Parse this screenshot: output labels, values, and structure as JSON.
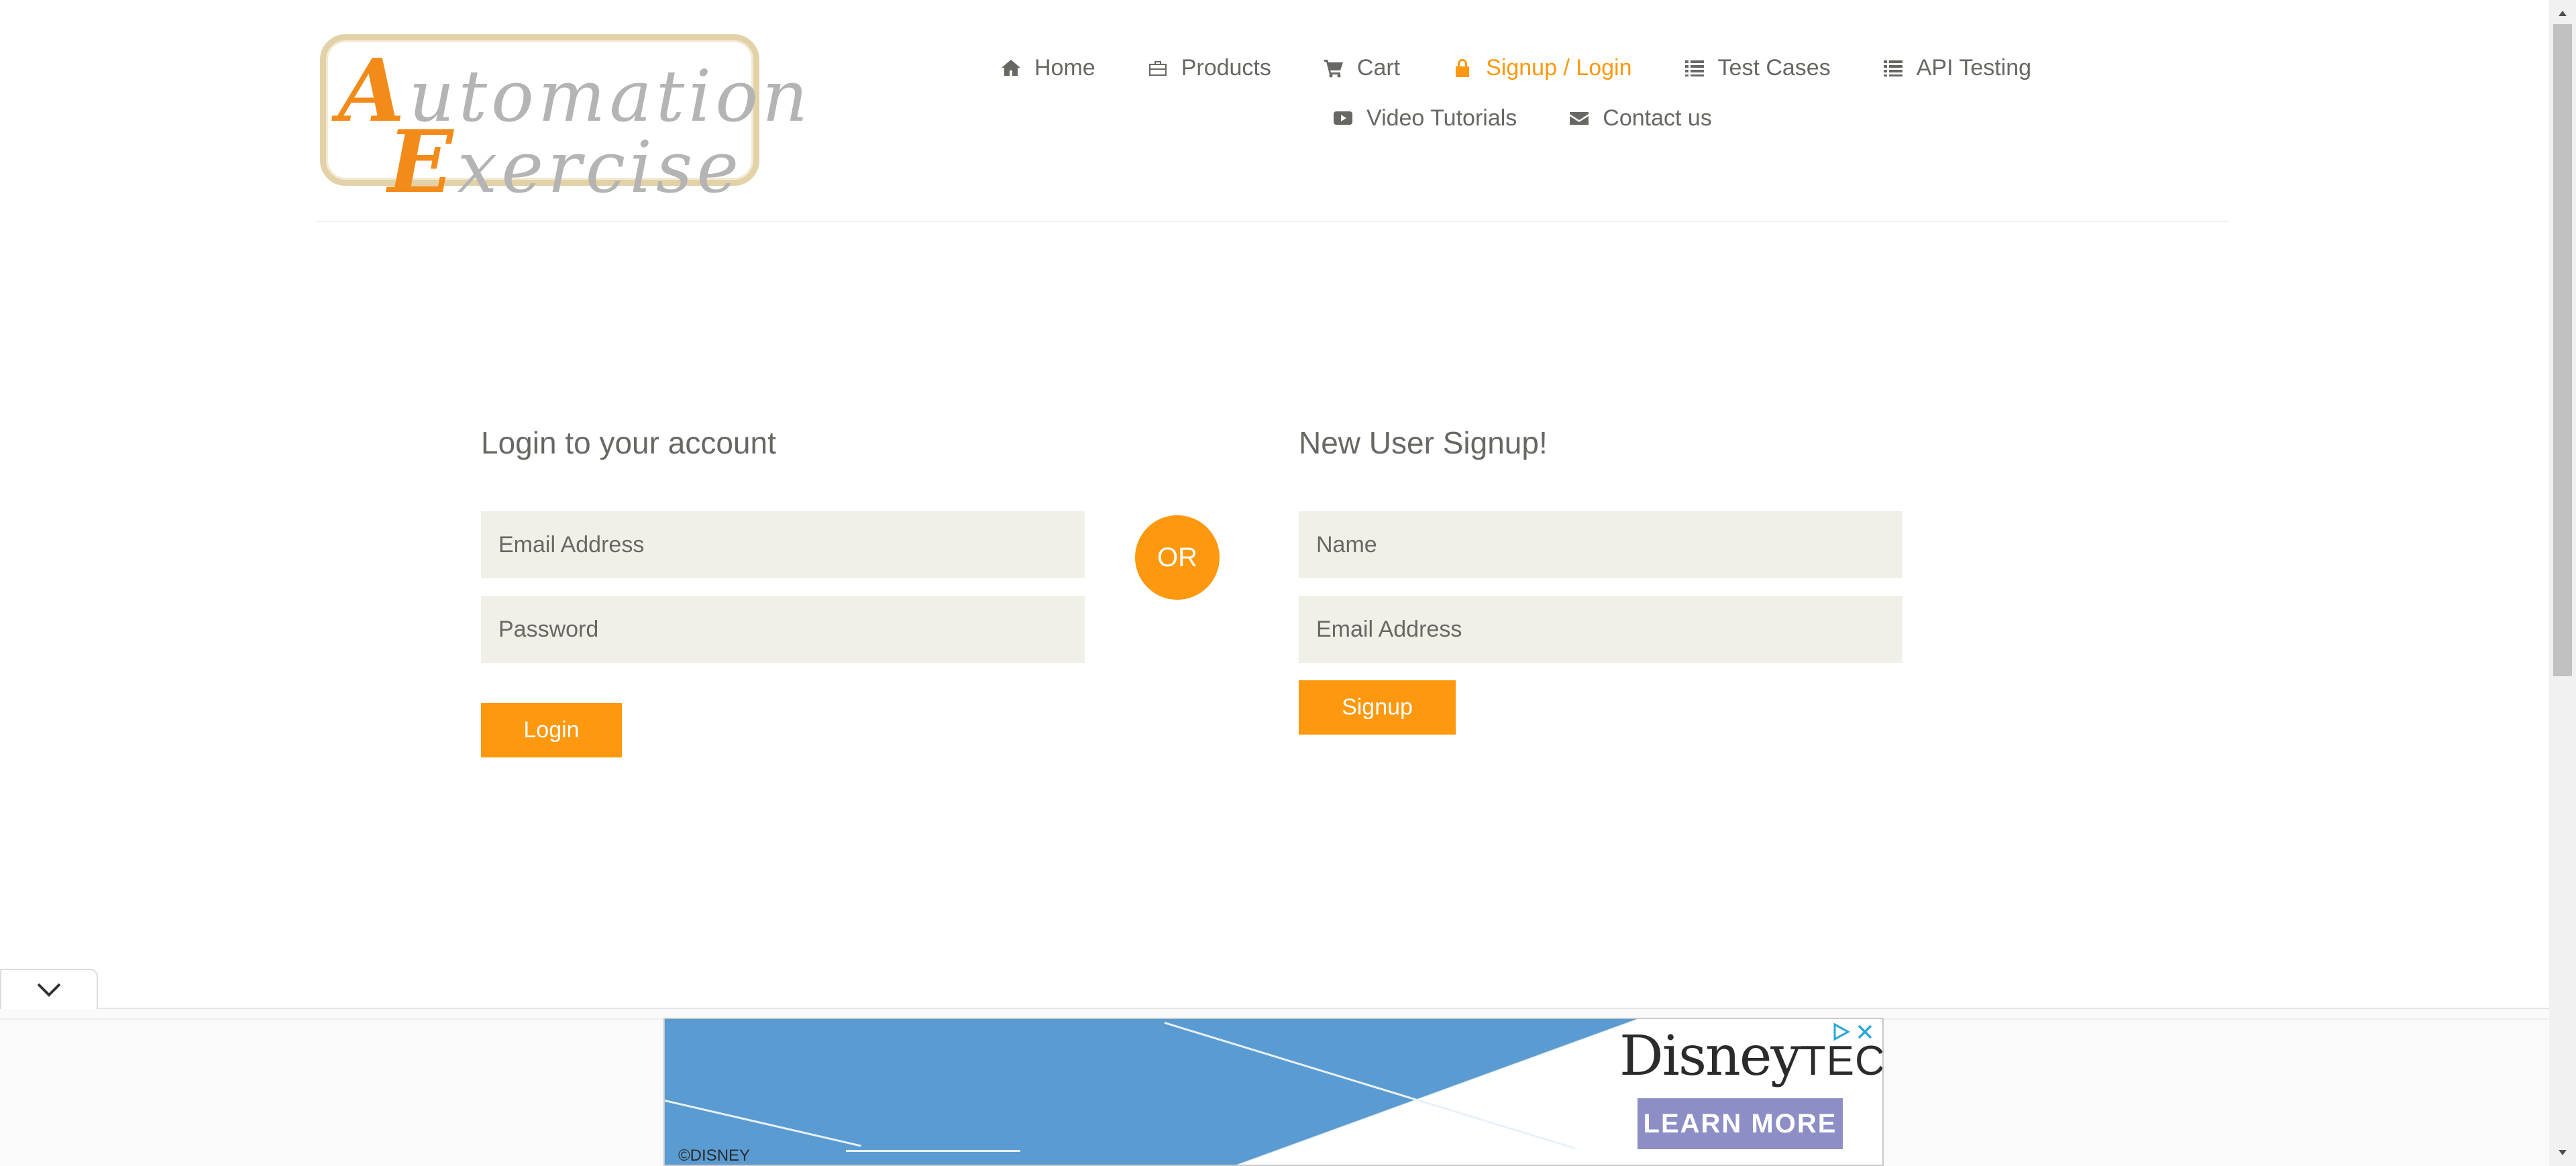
{
  "logo": {
    "line1_cap": "A",
    "line1_rest": "utomation",
    "line2_cap": "E",
    "line2_rest": "xercise"
  },
  "nav": {
    "items": [
      {
        "label": "Home",
        "icon": "home-icon",
        "active": false
      },
      {
        "label": "Products",
        "icon": "briefcase-icon",
        "active": false
      },
      {
        "label": "Cart",
        "icon": "cart-icon",
        "active": false
      },
      {
        "label": "Signup / Login",
        "icon": "lock-icon",
        "active": true
      },
      {
        "label": "Test Cases",
        "icon": "list-icon",
        "active": false
      },
      {
        "label": "API Testing",
        "icon": "list-icon",
        "active": false
      },
      {
        "label": "Video Tutorials",
        "icon": "youtube-play-icon",
        "active": false
      },
      {
        "label": "Contact us",
        "icon": "envelope-icon",
        "active": false
      }
    ]
  },
  "login": {
    "title": "Login to your account",
    "email_placeholder": "Email Address",
    "password_placeholder": "Password",
    "button": "Login"
  },
  "divider": {
    "label": "OR"
  },
  "signup": {
    "title": "New User Signup!",
    "name_placeholder": "Name",
    "email_placeholder": "Email Address",
    "button": "Signup"
  },
  "ad": {
    "brand": "Disney",
    "brand_suffix": "TECH",
    "cta": "LEARN MORE",
    "copyright": "©DISNEY"
  },
  "colors": {
    "accent": "#fe980f",
    "field_bg": "#f0f0e9",
    "text": "#696763",
    "ad_blue": "#5a9bd2"
  }
}
